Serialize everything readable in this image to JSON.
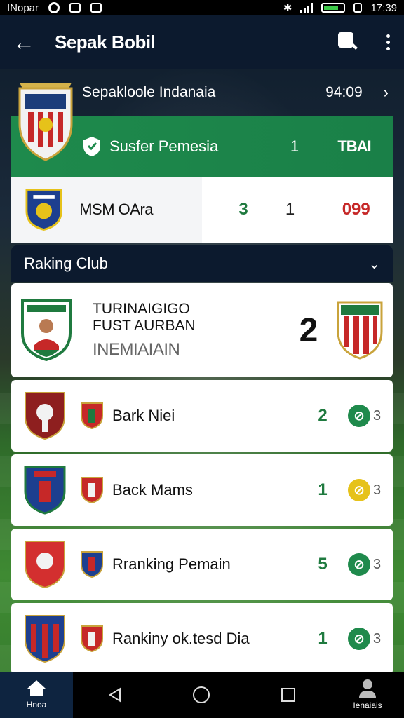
{
  "status_bar": {
    "carrier": "INopar",
    "time": "17:39"
  },
  "app_bar": {
    "title": "Sepak Bobil"
  },
  "league": {
    "name": "Sepakloole Indanaia",
    "time": "94:09"
  },
  "top_match": {
    "team": "Susfer Pemesia",
    "score_a": "1",
    "score_b": "TBAI"
  },
  "second_match": {
    "team": "MSM OAra",
    "val_a": "3",
    "val_b": "1",
    "val_c": "099"
  },
  "section": {
    "title": "Raking Club"
  },
  "featured": {
    "line1": "TURINAIGIGO",
    "line2": "FUST AURBAN",
    "line3": "INEMIAIAIN",
    "score": "2"
  },
  "rows": [
    {
      "name": "Bark Niei",
      "value": "2",
      "count": "3",
      "status_color": "#1f8a4c",
      "status_icon": "check-circle-icon"
    },
    {
      "name": "Back Mams",
      "value": "1",
      "count": "3",
      "status_color": "#e6c21a",
      "status_icon": "check-circle-icon"
    },
    {
      "name": "Rranking Pemain",
      "value": "5",
      "count": "3",
      "status_color": "#1f8a4c",
      "status_icon": "check-circle-icon"
    },
    {
      "name": "Rankiny ok.tesd Dia",
      "value": "1",
      "count": "3",
      "status_color": "#1f8a4c",
      "status_icon": "check-circle-icon"
    }
  ],
  "bottom_nav": {
    "home_label": "Hnoa",
    "profile_label": "Ienaiais"
  },
  "colors": {
    "primary_dark": "#0c1a2e",
    "green": "#1e8a4c",
    "red": "#c62828"
  }
}
